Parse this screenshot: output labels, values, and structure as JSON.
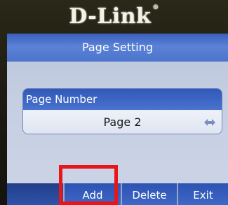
{
  "device": {
    "brand_logo": "D-Link",
    "registered_mark": "®"
  },
  "screen": {
    "title": "Page Setting",
    "field": {
      "label": "Page Number",
      "value": "Page 2",
      "adjust_icon": "left-right-arrows-icon"
    },
    "softkeys": [
      {
        "label": ""
      },
      {
        "label": "Add"
      },
      {
        "label": "Delete"
      },
      {
        "label": "Exit"
      }
    ]
  },
  "colors": {
    "header": "#4a73cf",
    "screen_bg": "#c6cfe2",
    "softkey": "#3e67c6",
    "highlight_box": "#e8161a"
  }
}
